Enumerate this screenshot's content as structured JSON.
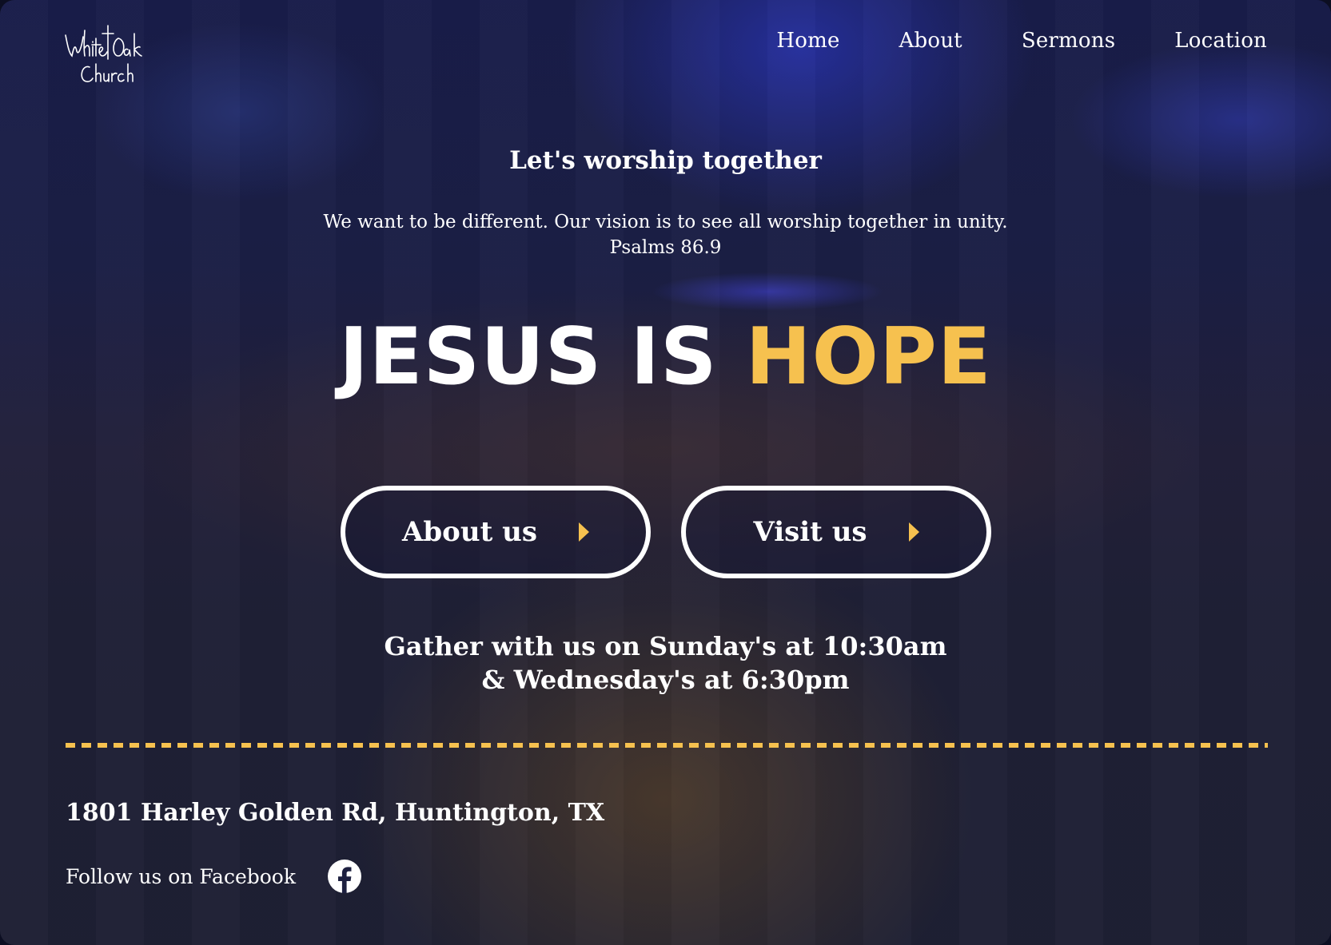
{
  "header": {
    "logo": {
      "line1": "White Oak",
      "line2": "Church"
    },
    "nav": [
      {
        "label": "Home"
      },
      {
        "label": "About"
      },
      {
        "label": "Sermons"
      },
      {
        "label": "Location"
      }
    ]
  },
  "hero": {
    "tagline": "Let's worship together",
    "vision": "We want to be different. Our vision is to see all worship together in unity.",
    "verse": "Psalms 86.9",
    "headline_part1": "JESUS IS",
    "headline_accent": "HOPE"
  },
  "buttons": {
    "about_label": "About us",
    "visit_label": "Visit us"
  },
  "schedule": {
    "line1": "Gather with us on Sunday's at 10:30am",
    "line2": "& Wednesday's at 6:30pm"
  },
  "footer": {
    "address": "1801 Harley Golden Rd, Huntington, TX",
    "follow_text": "Follow us on Facebook"
  },
  "icons": {
    "facebook": "facebook-icon",
    "caret": "caret-right-icon"
  },
  "colors": {
    "accent": "#f6c14f",
    "text": "#ffffff",
    "background": "#1b1f45"
  }
}
